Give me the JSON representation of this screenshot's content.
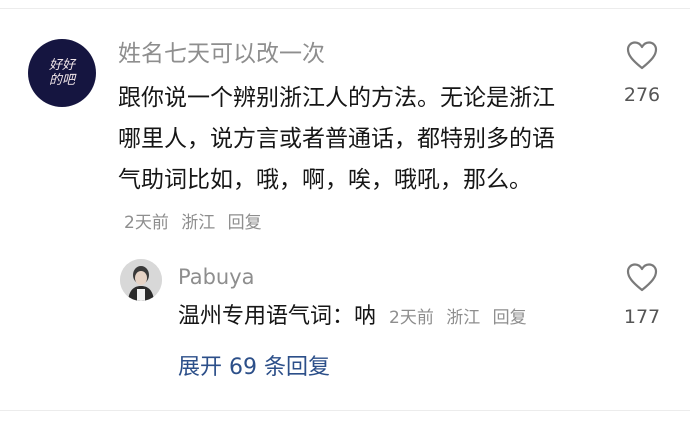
{
  "comment": {
    "author": "姓名七天可以改一次",
    "avatar_text": "好好的吧",
    "text": "跟你说一个辨别浙江人的方法。无论是浙江哪里人，说方言或者普通话，都特别多的语气助词比如，哦，啊，唉，哦吼，那么。",
    "time": "2天前",
    "location": "浙江",
    "reply_label": "回复",
    "likes": "276"
  },
  "reply": {
    "author": "Pabuya",
    "text": "温州专用语气词：呐",
    "time": "2天前",
    "location": "浙江",
    "reply_label": "回复",
    "likes": "177"
  },
  "expand_label": "展开 69 条回复",
  "icons": {
    "like": "heart-outline-icon"
  },
  "colors": {
    "meta": "#8e8e8e",
    "link": "#2c4f89",
    "avatar_bg": "#151540"
  }
}
